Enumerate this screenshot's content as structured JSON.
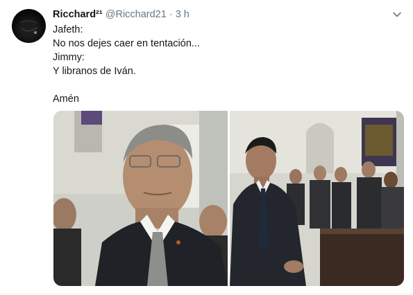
{
  "tweet": {
    "display_name": "Ricchard²¹",
    "handle": "@Ricchard21",
    "separator": "·",
    "time": "3 h",
    "lines": [
      "Jafeth:",
      "No nos dejes caer en tentación...",
      "Jimmy:",
      "Y libranos de Iván.",
      "",
      "Amén"
    ]
  },
  "icons": {
    "avatar": "avatar-image",
    "caret": "chevron-down-icon"
  },
  "colors": {
    "text": "#14171a",
    "secondary": "#657786",
    "divider": "#e6ecf0"
  }
}
